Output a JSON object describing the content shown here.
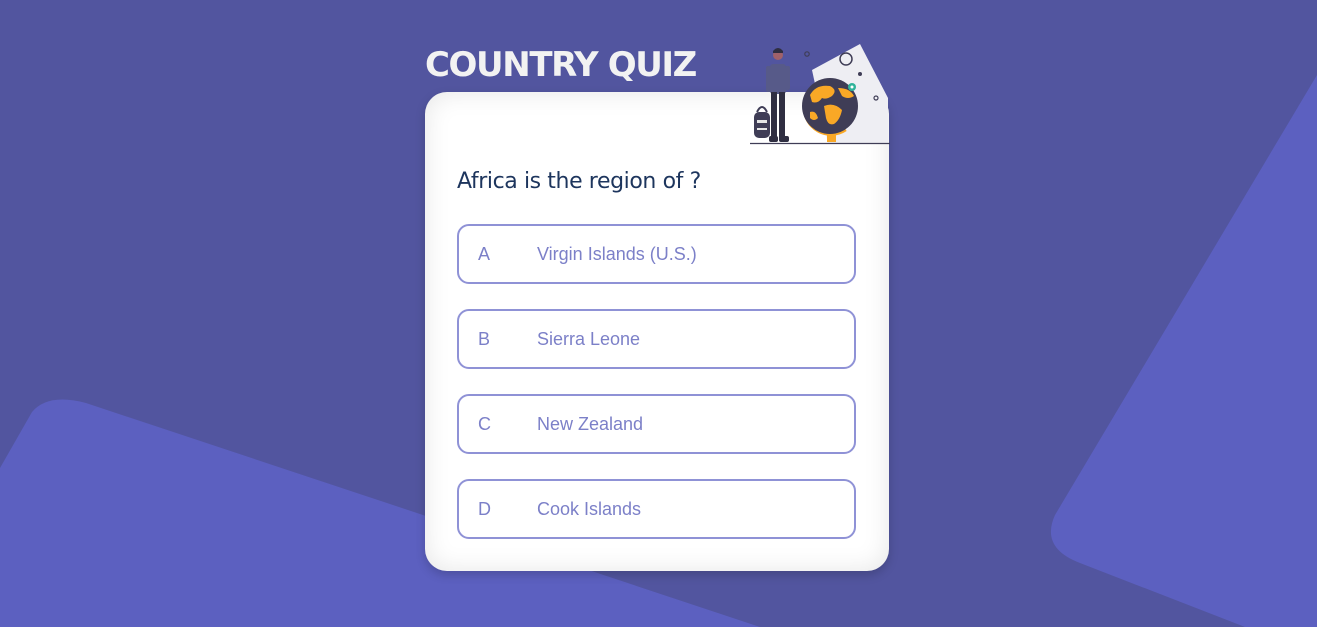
{
  "app": {
    "title": "COUNTRY QUIZ"
  },
  "colors": {
    "background": "#52559f",
    "shapes": "#5c60c0",
    "card": "#ffffff",
    "question_text": "#1d355d",
    "option_border": "#8f92d6",
    "option_text": "#7c80c8",
    "accent_orange": "#f9a826"
  },
  "illustration": {
    "icon": "traveler-globe-illustration"
  },
  "question": {
    "text": "Africa is the region of ?"
  },
  "options": [
    {
      "letter": "A",
      "text": "Virgin Islands (U.S.)"
    },
    {
      "letter": "B",
      "text": "Sierra Leone"
    },
    {
      "letter": "C",
      "text": "New Zealand"
    },
    {
      "letter": "D",
      "text": "Cook Islands"
    }
  ]
}
